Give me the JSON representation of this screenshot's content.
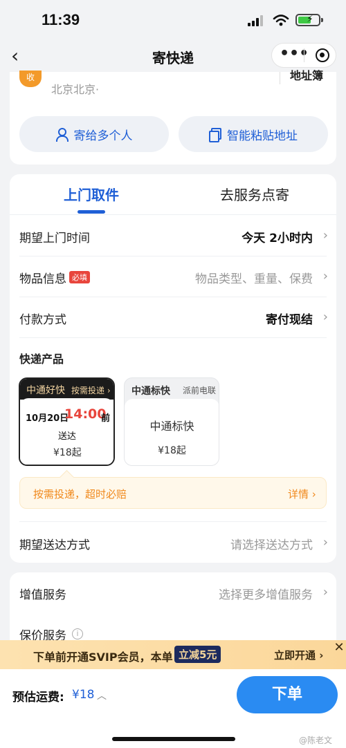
{
  "status_bar": {
    "time": "11:39"
  },
  "nav": {
    "back": "‹",
    "title": "寄快递",
    "more": "•••"
  },
  "address": {
    "badge": "收",
    "text": "北京北京·",
    "book": "地址簿"
  },
  "quick_actions": [
    {
      "label": "寄给多个人"
    },
    {
      "label": "智能粘贴地址"
    }
  ],
  "tabs": [
    {
      "label": "上门取件",
      "active": true
    },
    {
      "label": "去服务点寄",
      "active": false
    }
  ],
  "rows": {
    "pickup_time": {
      "label": "期望上门时间",
      "value": "今天 2小时内"
    },
    "item_info": {
      "label": "物品信息",
      "required": "必填",
      "placeholder": "物品类型、重量、保费"
    },
    "payment": {
      "label": "付款方式",
      "value": "寄付现结"
    },
    "delivery_method": {
      "label": "期望送达方式",
      "placeholder": "请选择送达方式"
    },
    "value_added": {
      "label": "增值服务",
      "placeholder": "选择更多增值服务"
    },
    "insured": {
      "label": "保价服务",
      "info_icon": "i"
    }
  },
  "products": {
    "title": "快递产品",
    "items": [
      {
        "name": "中通好快",
        "tag": "按需投递 ›",
        "date": "10月20日",
        "time": "14:00",
        "before": "前",
        "deliver": "送达",
        "price": "¥18起"
      },
      {
        "name": "中通标快",
        "tag": "派前电联",
        "title": "中通标快",
        "price": "¥18起"
      }
    ],
    "promo": {
      "text": "按需投递，超时必赔",
      "detail": "详情 ›"
    }
  },
  "svip_banner": {
    "text": "下单前开通SVIP会员，本单",
    "badge": "立减5元",
    "action": "立即开通 ›",
    "close": "✕"
  },
  "bottom": {
    "fee_label": "预估运费:",
    "fee_value": "¥18",
    "fee_caret": "︿",
    "order": "下单",
    "watermark": "@陈老文"
  },
  "colors": {
    "accent": "#1f5fd6",
    "order_button": "#2a8bf2",
    "required": "#e8453c",
    "promo": "#f0891c",
    "badge": "#f39a2a"
  }
}
